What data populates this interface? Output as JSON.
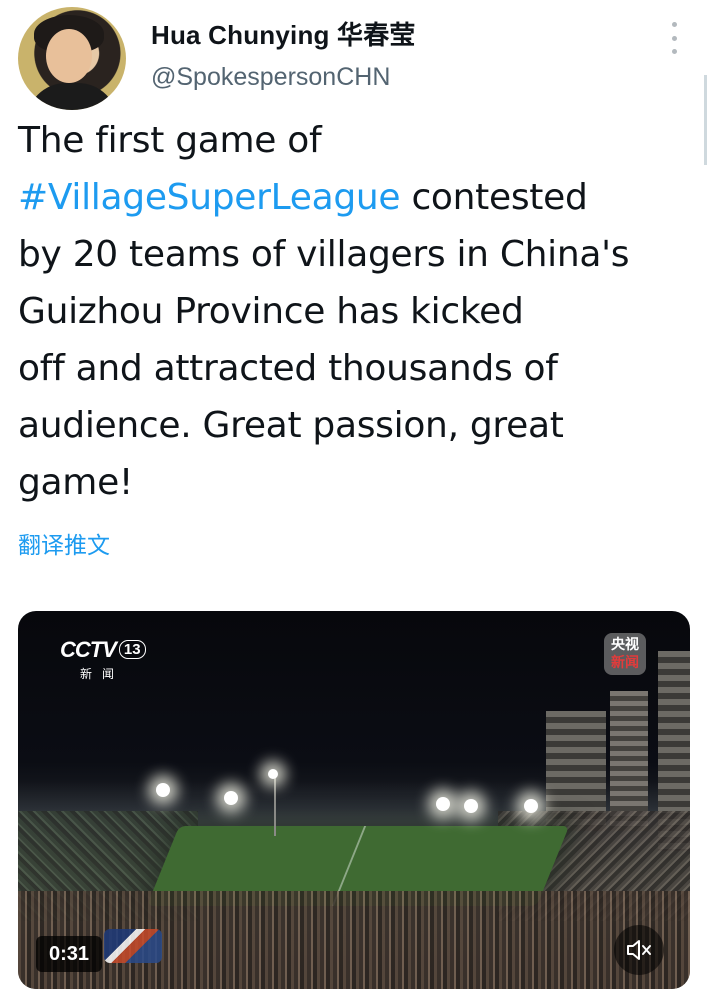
{
  "author": {
    "name": "Hua Chunying 华春莹",
    "handle": "@SpokespersonCHN",
    "avatar_icon": "profile-photo"
  },
  "menu": {
    "icon": "more-vertical-icon"
  },
  "tweet": {
    "lines": [
      {
        "text": "The first game of",
        "hashtag": ""
      },
      {
        "text": " contested",
        "hashtag": "#VillageSuperLeague"
      },
      {
        "text": "by 20 teams of villagers in China's",
        "hashtag": ""
      },
      {
        "text": "Guizhou Province has kicked",
        "hashtag": ""
      },
      {
        "text": "off and attracted thousands of",
        "hashtag": ""
      },
      {
        "text": "audience. Great passion, great",
        "hashtag": ""
      },
      {
        "text": "game!",
        "hashtag": ""
      }
    ],
    "hashtag_color": "#1d9bf0"
  },
  "translate_link": "翻译推文",
  "video": {
    "channel_logo": "CCTV",
    "channel_number": "13",
    "channel_sub": "新闻",
    "corner_logo_top": "央视",
    "corner_logo_bottom": "新闻",
    "duration": "0:31",
    "mute_icon": "muted-speaker-icon"
  }
}
